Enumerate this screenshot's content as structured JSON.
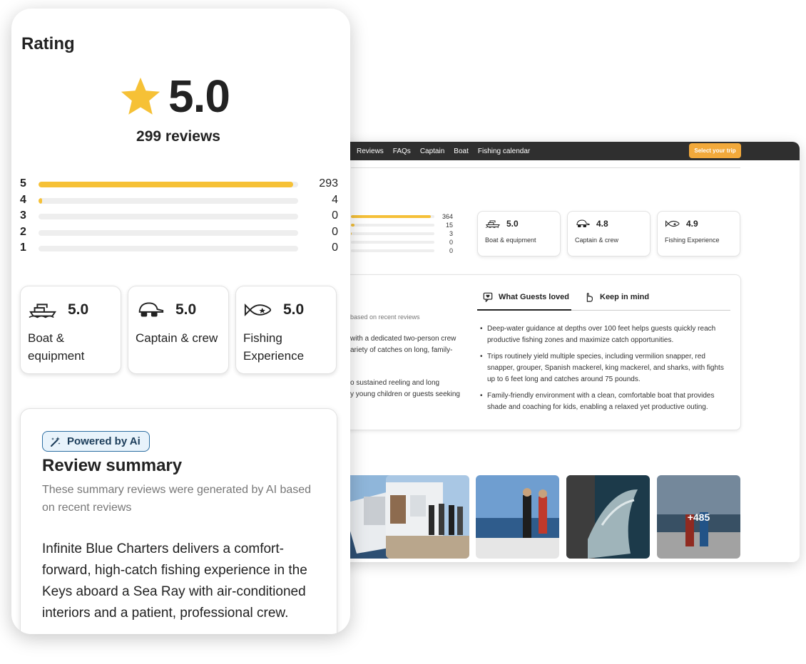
{
  "desktop": {
    "nav": {
      "items": [
        "s",
        "Reviews",
        "FAQs",
        "Captain",
        "Boat",
        "Fishing calendar"
      ],
      "cta": "Select your trip"
    },
    "rating_bars": [
      {
        "count": "364",
        "fill": 0.96
      },
      {
        "count": "15",
        "fill": 0.04
      },
      {
        "count": "3",
        "fill": 0.01
      },
      {
        "count": "0",
        "fill": 0
      },
      {
        "count": "0",
        "fill": 0
      }
    ],
    "categories": [
      {
        "score": "5.0",
        "label": "Boat & equipment",
        "icon": "boat-icon"
      },
      {
        "score": "4.8",
        "label": "Captain & crew",
        "icon": "captain-cap-icon"
      },
      {
        "score": "4.9",
        "label": "Fishing Experience",
        "icon": "fish-icon"
      }
    ],
    "summary": {
      "left_lines": [
        "based on recent reviews",
        "with a dedicated two-person crew",
        "ariety of catches on long, family-",
        "o sustained reeling and long",
        "y young children or guests seeking"
      ],
      "tabs": [
        "What Guests loved",
        "Keep in mind"
      ],
      "bullets": [
        "Deep-water guidance at depths over 100 feet helps guests quickly reach productive fishing zones and maximize catch opportunities.",
        "Trips routinely yield multiple species, including vermilion snapper, red snapper, grouper, Spanish mackerel, king mackerel, and sharks, with fights up to 6 feet long and catches around 75 pounds.",
        "Family-friendly environment with a clean, comfortable boat that provides shade and coaching for kids, enabling a relaxed yet productive outing."
      ]
    },
    "photos_more": "+485"
  },
  "mobile": {
    "title": "Rating",
    "score": "5.0",
    "reviews": "299 reviews",
    "bars": [
      {
        "star": "5",
        "count": "293",
        "fill": 0.98
      },
      {
        "star": "4",
        "count": "4",
        "fill": 0.014
      },
      {
        "star": "3",
        "count": "0",
        "fill": 0
      },
      {
        "star": "2",
        "count": "0",
        "fill": 0
      },
      {
        "star": "1",
        "count": "0",
        "fill": 0
      }
    ],
    "categories": [
      {
        "score": "5.0",
        "label": "Boat & equipment",
        "icon": "boat-icon"
      },
      {
        "score": "5.0",
        "label": "Captain & crew",
        "icon": "captain-cap-icon"
      },
      {
        "score": "5.0",
        "label": "Fishing Experience",
        "icon": "fish-icon"
      }
    ],
    "summary": {
      "badge": "Powered by Ai",
      "title": "Review summary",
      "subtitle": "These summary reviews were generated by AI based on recent reviews",
      "body": "Infinite Blue Charters delivers a comfort-forward, high-catch fishing experience in the Keys aboard a Sea Ray with air-conditioned interiors and a patient, professional crew."
    }
  },
  "colors": {
    "star": "#f6c136",
    "nav": "#2f2f2f",
    "cta": "#f2a93b",
    "badge_border": "#2c6ea1"
  }
}
